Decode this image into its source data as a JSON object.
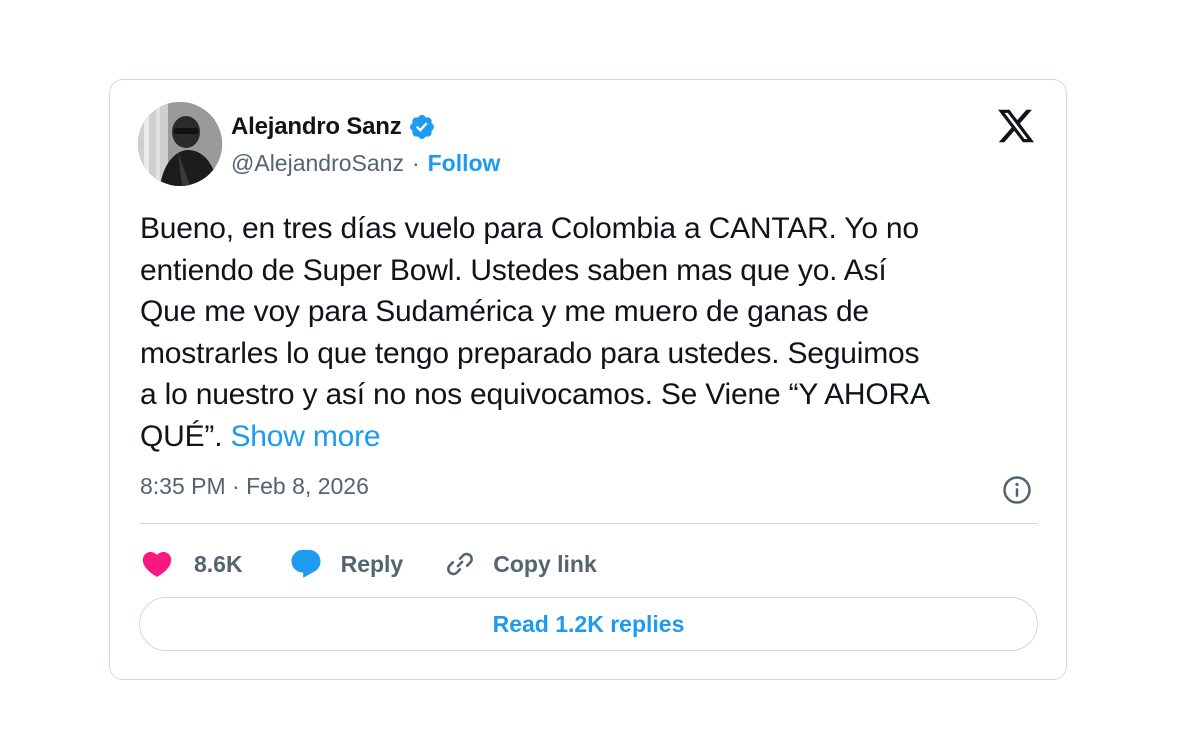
{
  "author": {
    "display_name": "Alejandro Sanz",
    "handle": "@AlejandroSanz",
    "separator": "·",
    "follow_label": "Follow",
    "verified_icon": "verified-badge-icon"
  },
  "tweet": {
    "text": "Bueno, en tres días vuelo para Colombia a CANTAR. Yo no\nentiendo de Super Bowl. Ustedes saben mas que yo. Así\nQue me voy para Sudamérica y me muero de ganas de\nmostrarles lo que tengo preparado para ustedes. Seguimos\na lo nuestro y así no nos equivocamos. Se Viene “Y AHORA\nQUÉ”. ",
    "show_more_label": "Show more",
    "timestamp": "8:35 PM · Feb 8, 2026"
  },
  "actions": {
    "like_count": "8.6K",
    "reply_label": "Reply",
    "copy_link_label": "Copy link"
  },
  "read_replies_label": "Read 1.2K replies",
  "colors": {
    "accent": "#1d9bf0",
    "like": "#f91880",
    "text": "#0f1419",
    "secondary": "#536471",
    "border": "#cfd9de"
  },
  "icons": [
    "x-logo-icon",
    "verified-badge-icon",
    "info-icon",
    "heart-icon",
    "reply-bubble-icon",
    "link-icon"
  ]
}
